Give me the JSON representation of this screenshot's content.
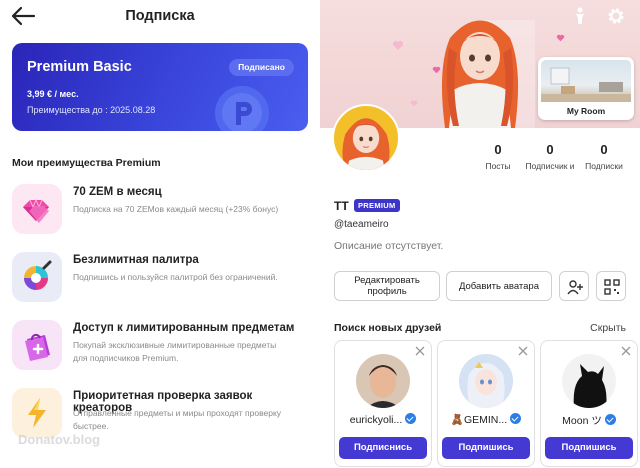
{
  "left": {
    "title": "Подписка",
    "card": {
      "plan_name": "Premium Basic",
      "status_badge": "Подписано",
      "price": "3,99 € / мес.",
      "valid_until": "Преимущества до : 2025.08.28"
    },
    "section_title": "Мои преимущества Premium",
    "benefits": [
      {
        "title": "70 ZEM в месяц",
        "desc": "Подписка на 70 ZEMов каждый месяц (+23% бонус)",
        "icon": "gem-icon"
      },
      {
        "title": "Безлимитная палитра",
        "desc": "Подпишись и пользуйся палитрой без ограничений.",
        "icon": "palette-icon"
      },
      {
        "title": "Доступ к лимитированным предметам",
        "desc": "Покупай эксклюзивные лимитированные предметы для подписчиков Premium.",
        "icon": "shopping-bag-icon"
      },
      {
        "title": "Приоритетная проверка заявок креаторов",
        "desc": "Отправленные предметы и миры проходят проверку быстрее.",
        "icon": "lightning-icon"
      }
    ],
    "watermark": "Donatov.blog"
  },
  "right": {
    "my_room_label": "My Room",
    "stats": [
      {
        "value": "0",
        "label": "Посты"
      },
      {
        "value": "0",
        "label": "Подписчик и"
      },
      {
        "value": "0",
        "label": "Подписки"
      }
    ],
    "username": "TT",
    "premium_badge": "PREMIUM",
    "handle": "@taeameiro",
    "bio": "Описание отсутствует.",
    "edit_profile": "Редактировать профиль",
    "add_avatar": "Добавить аватара",
    "find_friends_title": "Поиск новых друзей",
    "hide_label": "Скрыть",
    "friends": [
      {
        "name": "eurickyoli...",
        "button": "Подписнись"
      },
      {
        "name": "🧸GEMIN...",
        "button": "Подпишись"
      },
      {
        "name": "Moon ツ",
        "button": "Подпишись"
      }
    ]
  },
  "colors": {
    "accent": "#4539d4",
    "card_start": "#2a25b8",
    "card_end": "#4a5ef0",
    "verified": "#2b7ee6"
  }
}
